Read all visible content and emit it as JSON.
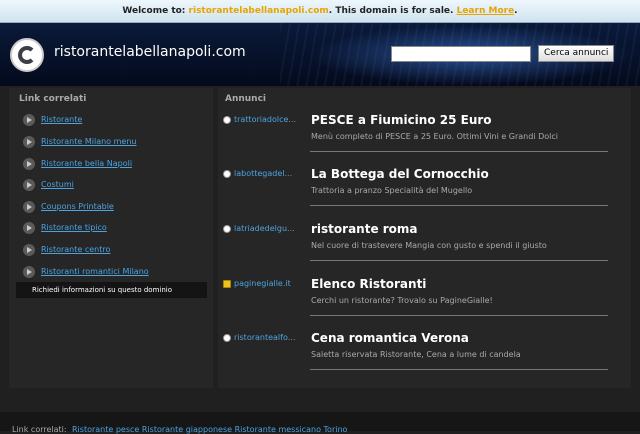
{
  "banner": {
    "prefix": "Welcome to:",
    "domain": "ristorantelabellanapoli.com",
    "message": ". This domain is for sale.",
    "learn_more": "Learn More",
    "after": "."
  },
  "header": {
    "site_title": "ristorantelabellanapoli.com",
    "search_value": "",
    "search_button": "Cerca annunci"
  },
  "related": {
    "heading": "Link correlati",
    "items": [
      "Ristorante",
      "Ristorante Milano menu",
      "Ristorante bella Napoli",
      "Costumi",
      "Coupons Printable",
      "Ristorante tipico",
      "Ristorante centro",
      "Ristoranti romantici Milano"
    ],
    "request_info": "Richiedi informazioni su questo dominio"
  },
  "ads": {
    "heading": "Annunci",
    "items": [
      {
        "source": "trattoriadolce...",
        "title": "PESCE a Fiumicino 25 Euro",
        "desc": "Menù completo di PESCE a 25 Euro. Ottimi Vini e Grandi Dolci",
        "icon": "globe-icon"
      },
      {
        "source": "labottegadel...",
        "title": "La Bottega del Cornocchio",
        "desc": "Trattoria a pranzo Specialità del Mugello",
        "icon": "globe-icon"
      },
      {
        "source": "latriadedelgu...",
        "title": "ristorante roma",
        "desc": "Nel cuore di trastevere Mangia con gusto e spendi il giusto",
        "icon": "globe-icon"
      },
      {
        "source": "paginegialle.it",
        "title": "Elenco Ristoranti",
        "desc": "Cerchi un ristorante? Trovalo su PagineGialle!",
        "icon": "paginegialle-icon"
      },
      {
        "source": "ristorantealfo...",
        "title": "Cena romantica Verona",
        "desc": "Saletta riservata Ristorante, Cena a lume di candela",
        "icon": "globe-icon"
      }
    ]
  },
  "footer": {
    "label": "Link correlati:",
    "links": "Ristorante pesce  Ristorante giapponese  Ristorante messicano Torino"
  }
}
